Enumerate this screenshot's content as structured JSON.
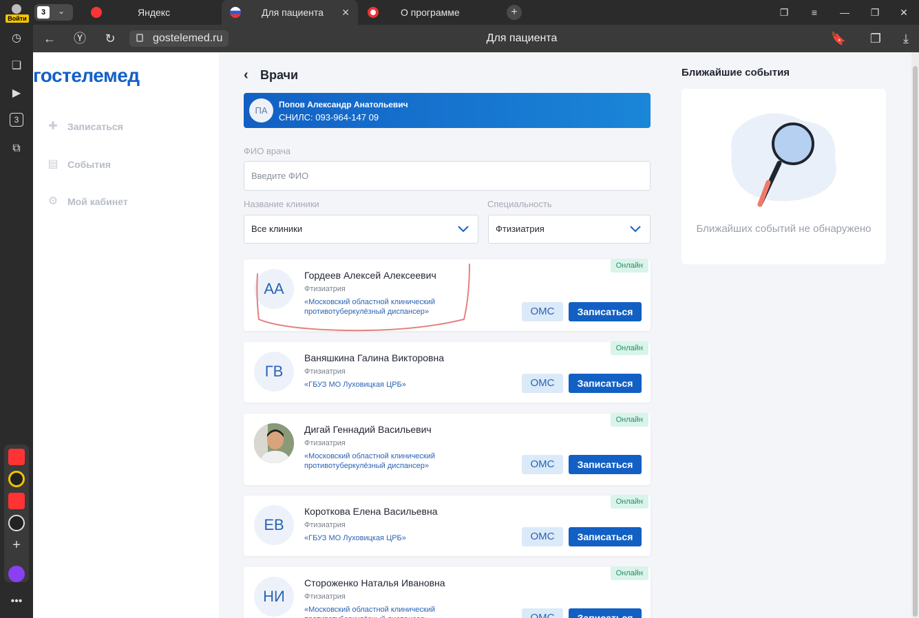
{
  "browser": {
    "login_label": "Войти",
    "tab_count": "3",
    "tabs": [
      {
        "title": "Яндекс"
      },
      {
        "title": "Для пациента"
      },
      {
        "title": "О программе"
      }
    ],
    "url": "gostelemed.ru",
    "page_title": "Для пациента",
    "sidebar_badge": "3"
  },
  "logo": "гостелемед",
  "menu": [
    {
      "label": "Записаться",
      "icon": "plus-icon"
    },
    {
      "label": "События",
      "icon": "clipboard-icon"
    },
    {
      "label": "Мой кабинет",
      "icon": "gear-icon"
    }
  ],
  "header": {
    "back_label": "Врачи"
  },
  "patient": {
    "initials": "ПА",
    "name": "Попов Александр Анатольевич",
    "snils": "СНИЛС: 093-964-147 09"
  },
  "filters": {
    "fio_label": "ФИО врача",
    "fio_placeholder": "Введите ФИО",
    "clinic_label": "Название клиники",
    "clinic_value": "Все клиники",
    "spec_label": "Специальность",
    "spec_value": "Фтизиатрия"
  },
  "doctors": [
    {
      "initials": "АА",
      "name": "Гордеев Алексей Алексеевич",
      "spec": "Фтизиатрия",
      "clinic": "«Московский областной клинический противотуберкулёзный диспансер»",
      "status": "Онлайн",
      "oms": "ОМС",
      "book": "Записаться",
      "photo": false
    },
    {
      "initials": "ГВ",
      "name": "Ваняшкина Галина Викторовна",
      "spec": "Фтизиатрия",
      "clinic": "«ГБУЗ МО Луховицкая ЦРБ»",
      "status": "Онлайн",
      "oms": "ОМС",
      "book": "Записаться",
      "photo": false
    },
    {
      "initials": "",
      "name": "Дигай Геннадий Васильевич",
      "spec": "Фтизиатрия",
      "clinic": "«Московский областной клинический противотуберкулёзный диспансер»",
      "status": "Онлайн",
      "oms": "ОМС",
      "book": "Записаться",
      "photo": true
    },
    {
      "initials": "ЕВ",
      "name": "Короткова Елена Васильевна",
      "spec": "Фтизиатрия",
      "clinic": "«ГБУЗ МО Луховицкая ЦРБ»",
      "status": "Онлайн",
      "oms": "ОМС",
      "book": "Записаться",
      "photo": false
    },
    {
      "initials": "НИ",
      "name": "Стороженко Наталья Ивановна",
      "spec": "Фтизиатрия",
      "clinic": "«Московский областной клинический противотуберкулёзный диспансер»",
      "status": "Онлайн",
      "oms": "ОМС",
      "book": "Записаться",
      "photo": false
    }
  ],
  "events": {
    "title": "Ближайшие события",
    "empty_text": "Ближайших событий не обнаружено"
  },
  "colors": {
    "primary": "#1260c4",
    "online_bg": "#d9f4ea",
    "annotation": "#e06a6a"
  }
}
